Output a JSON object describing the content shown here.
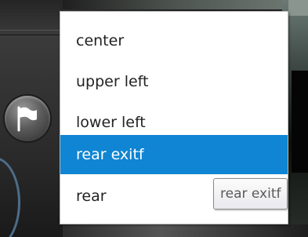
{
  "colors": {
    "selection": "#0f85d3",
    "menu_background": "#ffffff",
    "menu_text": "#222222",
    "tooltip_text": "#5a5a5a"
  },
  "flag_button": {
    "icon": "flag-icon"
  },
  "dropdown": {
    "items": [
      {
        "label": "center",
        "selected": false
      },
      {
        "label": "upper left",
        "selected": false
      },
      {
        "label": "lower left",
        "selected": false
      },
      {
        "label": "rear exitf",
        "selected": true
      },
      {
        "label": "rear",
        "selected": false
      }
    ]
  },
  "tooltip": {
    "text": "rear exitf"
  }
}
